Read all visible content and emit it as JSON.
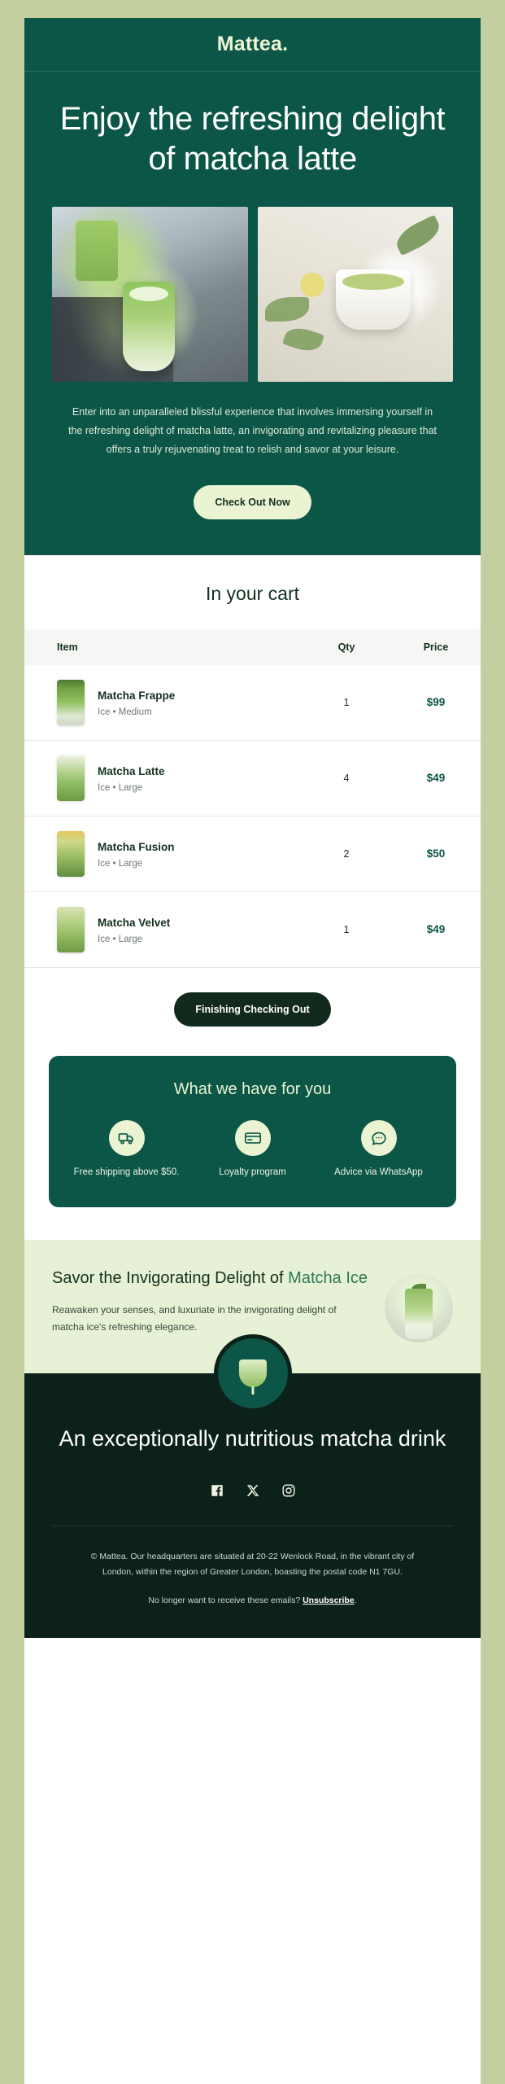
{
  "brand": {
    "logo": "Mattea."
  },
  "hero": {
    "headline": "Enjoy the refreshing delight of matcha latte",
    "paragraph": "Enter into an unparalleled blissful experience that involves immersing yourself in the refreshing delight of matcha latte, an invigorating and revitalizing pleasure that offers a truly rejuvenating treat to relish and savor at your leisure.",
    "cta_label": "Check Out Now",
    "images": [
      {
        "alt": "matcha latte glass on tray"
      },
      {
        "alt": "matcha being poured into mug with leaves"
      }
    ]
  },
  "cart": {
    "title": "In your cart",
    "columns": {
      "item": "Item",
      "qty": "Qty",
      "price": "Price"
    },
    "rows": [
      {
        "name": "Matcha Frappe",
        "meta": "Ice • Medium",
        "qty": "1",
        "price": "$99"
      },
      {
        "name": "Matcha Latte",
        "meta": "Ice • Large",
        "qty": "4",
        "price": "$49"
      },
      {
        "name": "Matcha Fusion",
        "meta": "Ice • Large",
        "qty": "2",
        "price": "$50"
      },
      {
        "name": "Matcha Velvet",
        "meta": "Ice • Large",
        "qty": "1",
        "price": "$49"
      }
    ],
    "checkout_label": "Finishing Checking Out"
  },
  "benefits": {
    "title": "What we have for you",
    "items": [
      {
        "icon": "truck-icon",
        "label": "Free shipping above $50."
      },
      {
        "icon": "credit-card-icon",
        "label": "Loyalty program"
      },
      {
        "icon": "chat-icon",
        "label": "Advice via WhatsApp"
      }
    ]
  },
  "savor": {
    "title_plain": "Savor the Invigorating Delight of ",
    "title_highlight": "Matcha Ice",
    "body": "Reawaken your senses, and luxuriate in the invigorating delight of matcha ice's refreshing elegance."
  },
  "closing": {
    "headline": "An exceptionally nutritious matcha drink",
    "socials": [
      "facebook-icon",
      "x-twitter-icon",
      "instagram-icon"
    ]
  },
  "footer": {
    "legal": "© Mattea. Our headquarters are situated at 20-22 Wenlock Road, in the vibrant city of London, within the region of Greater London, boasting the postal code N1 7GU.",
    "unsub_prefix": "No longer want to receive these emails? ",
    "unsub_link": "Unsubscribe",
    "unsub_suffix": "."
  },
  "colors": {
    "page_bg": "#c3cf9e",
    "brand_green": "#0b5646",
    "cream": "#eaf4d2",
    "dark": "#0b211a",
    "light_green_panel": "#e7f1d5"
  }
}
